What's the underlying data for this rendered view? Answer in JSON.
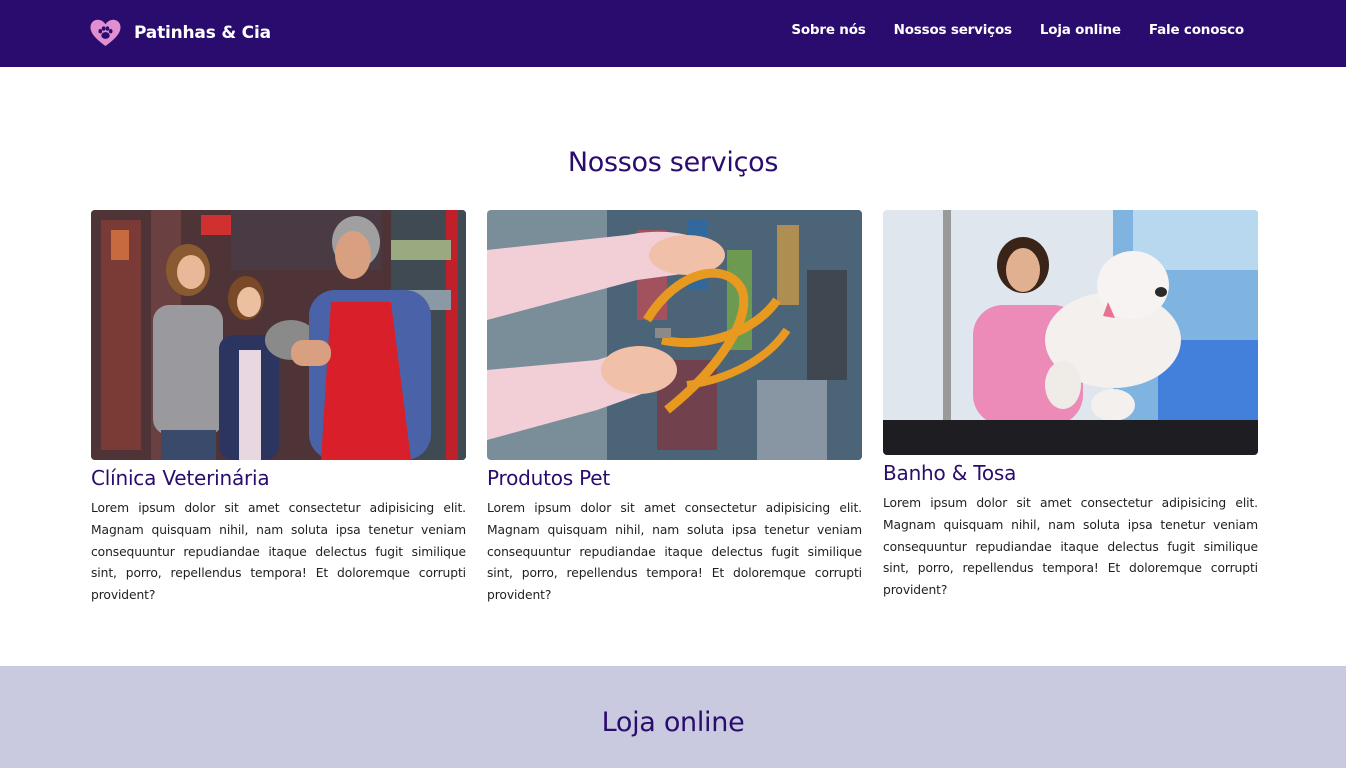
{
  "header": {
    "brand_name": "Patinhas & Cia",
    "logo_icon": "heart-paw-icon",
    "nav": [
      "Sobre nós",
      "Nossos serviços",
      "Loja online",
      "Fale conosco"
    ]
  },
  "services": {
    "title": "Nossos serviços",
    "cards": [
      {
        "title": "Clínica Veterinária",
        "text": "Lorem ipsum dolor sit amet consectetur adipisicing elit. Magnam quisquam nihil, nam soluta ipsa tenetur veniam consequuntur repudiandae itaque delectus fugit similique sint, porro, repellendus tempora! Et doloremque corrupti provident?"
      },
      {
        "title": "Produtos Pet",
        "text": "Lorem ipsum dolor sit amet consectetur adipisicing elit. Magnam quisquam nihil, nam soluta ipsa tenetur veniam consequuntur repudiandae itaque delectus fugit similique sint, porro, repellendus tempora! Et doloremque corrupti provident?"
      },
      {
        "title": "Banho & Tosa",
        "text": "Lorem ipsum dolor sit amet consectetur adipisicing elit. Magnam quisquam nihil, nam soluta ipsa tenetur veniam consequuntur repudiandae itaque delectus fugit similique sint, porro, repellendus tempora! Et doloremque corrupti provident?"
      }
    ]
  },
  "store": {
    "title": "Loja online"
  },
  "colors": {
    "primary": "#2a0c6e",
    "logo": "#e08fd0",
    "store_background": "#c9cae0"
  }
}
